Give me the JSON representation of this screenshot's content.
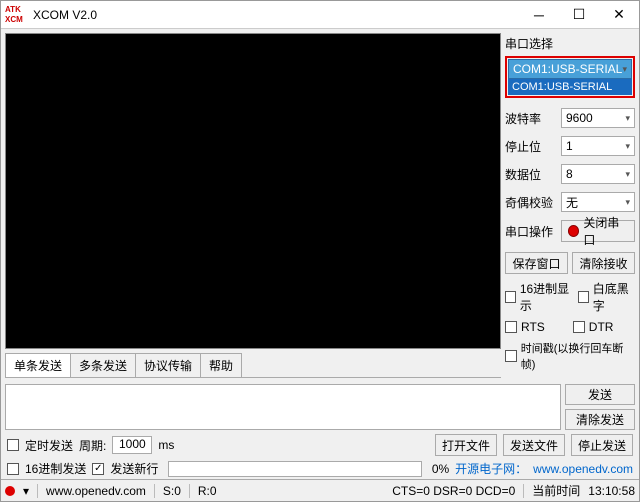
{
  "window": {
    "title": "XCOM V2.0",
    "icon_text": "ATK\nXCM"
  },
  "sidebar": {
    "port_section_label": "串口选择",
    "port_selected": "COM1:USB-SERIAL",
    "port_option": "COM1:USB-SERIAL",
    "baud_label": "波特率",
    "baud_value": "9600",
    "stop_label": "停止位",
    "stop_value": "1",
    "data_label": "数据位",
    "data_value": "8",
    "parity_label": "奇偶校验",
    "parity_value": "无",
    "op_label": "串口操作",
    "op_button": "关闭串口",
    "save_window": "保存窗口",
    "clear_recv": "清除接收",
    "hex_display": "16进制显示",
    "white_on_black": "白底黑字",
    "rts": "RTS",
    "dtr": "DTR",
    "timestamp": "时间戳(以换行回车断帧)"
  },
  "tabs": {
    "single": "单条发送",
    "multi": "多条发送",
    "proto": "协议传输",
    "help": "帮助"
  },
  "send": {
    "send": "发送",
    "clear_send": "清除发送",
    "timed": "定时发送",
    "period_label": "周期:",
    "period_value": "1000",
    "period_unit": "ms",
    "open_file": "打开文件",
    "send_file": "发送文件",
    "stop_send": "停止发送",
    "hex_send": "16进制发送",
    "newline": "发送新行",
    "percent": "0%",
    "link_label": "开源电子网：",
    "link_url": "www.openedv.com"
  },
  "status": {
    "site": "www.openedv.com",
    "s": "S:0",
    "r": "R:0",
    "cts": "CTS=0 DSR=0 DCD=0",
    "time_label": "当前时间",
    "time_value": "13:10:58"
  }
}
